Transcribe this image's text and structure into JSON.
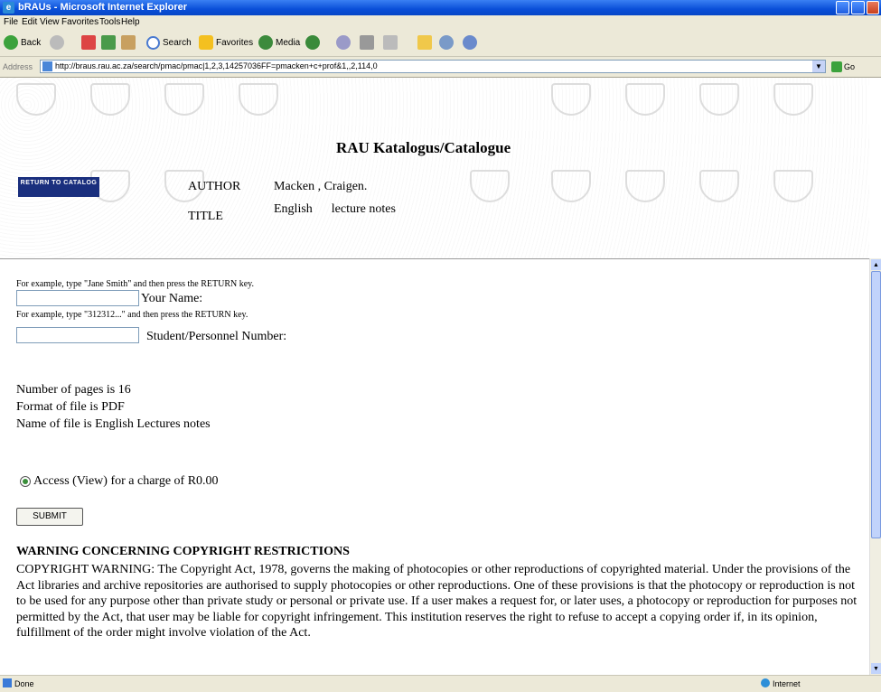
{
  "window": {
    "title": "bRAUs - Microsoft Internet Explorer"
  },
  "menu": [
    "File",
    "Edit",
    "View",
    "Favorites",
    "Tools",
    "Help"
  ],
  "toolbar": {
    "back": "Back",
    "search": "Search",
    "favorites": "Favorites",
    "media": "Media"
  },
  "address": {
    "label": "Address",
    "url": "http://braus.rau.ac.za/search/pmac/pmac|1,2,3,14257036FF=pmacken+c+prof&1,,2,114,0",
    "go": "Go"
  },
  "header": {
    "title": "RAU Katalogus/Catalogue",
    "return_button": "RETURN TO CATALOG",
    "author_label": "AUTHOR",
    "author_value": "Macken , Craigen.",
    "title_label": "TITLE",
    "title_value": "English      lecture notes"
  },
  "form": {
    "name_hint": "For example, type \"Jane Smith\" and then press the RETURN key.",
    "name_label": "Your Name:",
    "number_hint": "For example, type \"312312...\" and then press the RETURN key.",
    "number_label": "Student/Personnel Number:"
  },
  "file_info": {
    "pages": "Number of pages is 16",
    "format": "Format of file is PDF",
    "name": "Name of file is English Lectures notes"
  },
  "access_option": "Access (View) for a charge of R0.00",
  "submit_label": "SUBMIT",
  "warning": {
    "heading": "WARNING CONCERNING COPYRIGHT RESTRICTIONS",
    "text": "COPYRIGHT WARNING: The Copyright Act, 1978, governs the making of photocopies or other reproductions of copyrighted material. Under the provisions of the Act libraries and archive repositories are authorised to supply photocopies or other reproductions. One of these provisions is that the photocopy or reproduction is not to be used for any purpose other than private study or personal or private use. If a user makes a request for, or later uses, a photocopy or reproduction for purposes not permitted by the Act, that user may be liable for copyright infringement. This institution reserves the right to refuse to accept a copying order if, in its opinion, fulfillment of the order might involve violation of the Act."
  },
  "status": {
    "left": "Done",
    "zone": "Internet"
  }
}
